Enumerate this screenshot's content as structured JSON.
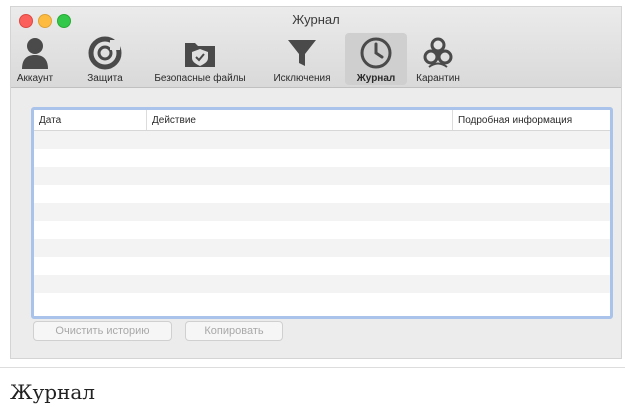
{
  "window": {
    "title": "Журнал"
  },
  "toolbar": {
    "items": [
      {
        "label": "Аккаунт",
        "icon": "account-icon",
        "active": false
      },
      {
        "label": "Защита",
        "icon": "protection-icon",
        "active": false
      },
      {
        "label": "Безопасные файлы",
        "icon": "safe-files-icon",
        "active": false
      },
      {
        "label": "Исключения",
        "icon": "filter-icon",
        "active": false
      },
      {
        "label": "Журнал",
        "icon": "clock-icon",
        "active": true
      },
      {
        "label": "Карантин",
        "icon": "biohazard-icon",
        "active": false
      }
    ]
  },
  "log_table": {
    "columns": [
      "Дата",
      "Действие",
      "Подробная информация"
    ],
    "rows": []
  },
  "buttons": {
    "clear_history": "Очистить историю",
    "copy": "Копировать"
  },
  "caption": "Журнал",
  "colors": {
    "window_bg": "#ececec",
    "focus_ring": "#a9c3ea",
    "active_tab_bg": "#cfcfcf",
    "disabled_text": "#a8a8a8"
  }
}
